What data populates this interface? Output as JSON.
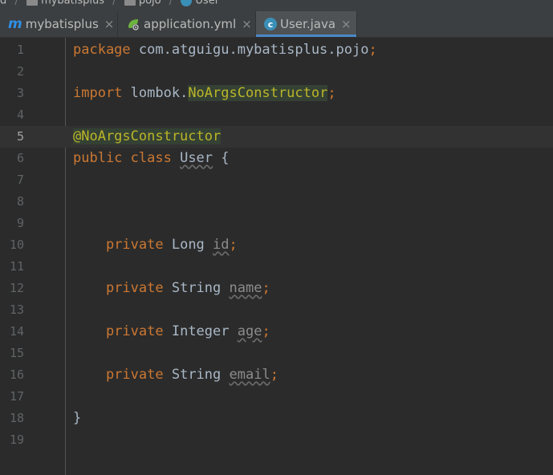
{
  "breadcrumb": [
    "d",
    "mybatisplus",
    "pojo",
    "User"
  ],
  "tabs": [
    {
      "label": "mybatisplus",
      "icon": "module-m-icon",
      "active": false
    },
    {
      "label": "application.yml",
      "icon": "spring-config-icon",
      "active": false
    },
    {
      "label": "User.java",
      "icon": "java-class-icon",
      "active": true
    }
  ],
  "tab_close_glyph": "×",
  "editor": {
    "current_line": 5,
    "lines": [
      {
        "n": "1",
        "tokens": [
          [
            "kw",
            "package"
          ],
          [
            "plain",
            " com.atguigu.mybatisplus.pojo"
          ],
          [
            "punct",
            ";"
          ]
        ]
      },
      {
        "n": "2",
        "tokens": []
      },
      {
        "n": "3",
        "tokens": [
          [
            "kw",
            "import"
          ],
          [
            "plain",
            " lombok."
          ],
          [
            "annhl",
            "NoArgsConstructor"
          ],
          [
            "punct",
            ";"
          ]
        ]
      },
      {
        "n": "4",
        "tokens": []
      },
      {
        "n": "5",
        "tokens": [
          [
            "annhl",
            "@NoArgsConstructor"
          ]
        ]
      },
      {
        "n": "6",
        "tokens": [
          [
            "kw",
            "public class"
          ],
          [
            "plain",
            " "
          ],
          [
            "squig",
            "User"
          ],
          [
            "plain",
            " {"
          ]
        ]
      },
      {
        "n": "7",
        "tokens": []
      },
      {
        "n": "8",
        "tokens": []
      },
      {
        "n": "9",
        "tokens": []
      },
      {
        "n": "10",
        "tokens": [
          [
            "plain",
            "    "
          ],
          [
            "kw",
            "private"
          ],
          [
            "plain",
            " Long "
          ],
          [
            "dim",
            "id"
          ],
          [
            "punct",
            ";"
          ]
        ]
      },
      {
        "n": "11",
        "tokens": []
      },
      {
        "n": "12",
        "tokens": [
          [
            "plain",
            "    "
          ],
          [
            "kw",
            "private"
          ],
          [
            "plain",
            " String "
          ],
          [
            "dim",
            "name"
          ],
          [
            "punct",
            ";"
          ]
        ]
      },
      {
        "n": "13",
        "tokens": []
      },
      {
        "n": "14",
        "tokens": [
          [
            "plain",
            "    "
          ],
          [
            "kw",
            "private"
          ],
          [
            "plain",
            " Integer "
          ],
          [
            "dim",
            "age"
          ],
          [
            "punct",
            ";"
          ]
        ]
      },
      {
        "n": "15",
        "tokens": []
      },
      {
        "n": "16",
        "tokens": [
          [
            "plain",
            "    "
          ],
          [
            "kw",
            "private"
          ],
          [
            "plain",
            " String "
          ],
          [
            "dim",
            "email"
          ],
          [
            "punct",
            ";"
          ]
        ]
      },
      {
        "n": "17",
        "tokens": []
      },
      {
        "n": "18",
        "tokens": [
          [
            "plain",
            "}"
          ]
        ]
      },
      {
        "n": "19",
        "tokens": []
      }
    ]
  },
  "colors": {
    "background": "#2b2b2b",
    "keyword": "#cc7832",
    "annotation": "#bbb529",
    "text": "#a9b7c6",
    "line_number": "#606366",
    "active_tab_underline": "#4a88c7"
  }
}
